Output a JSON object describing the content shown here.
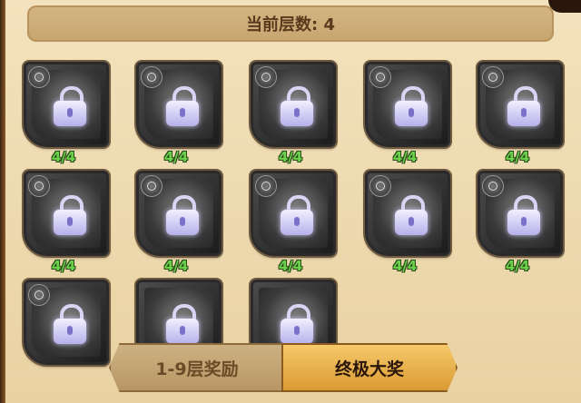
{
  "header": {
    "title": "当前层数: 4"
  },
  "heroes": [
    {
      "id": "hero-1",
      "progress": "4/4",
      "locked": true
    },
    {
      "id": "hero-2",
      "progress": "4/4",
      "locked": true
    },
    {
      "id": "hero-3",
      "progress": "4/4",
      "locked": true
    },
    {
      "id": "hero-4",
      "progress": "4/4",
      "locked": true
    },
    {
      "id": "hero-5",
      "progress": "4/4",
      "locked": true
    },
    {
      "id": "hero-6",
      "progress": "4/4",
      "locked": true
    },
    {
      "id": "hero-7",
      "progress": "4/4",
      "locked": true
    },
    {
      "id": "hero-8",
      "progress": "4/4",
      "locked": true
    },
    {
      "id": "hero-9",
      "progress": "4/4",
      "locked": true
    },
    {
      "id": "hero-10",
      "progress": "4/4",
      "locked": true
    },
    {
      "id": "hero-11",
      "progress": "",
      "locked": true
    },
    {
      "id": "hero-12",
      "progress": "",
      "locked": true
    },
    {
      "id": "hero-13",
      "progress": "",
      "locked": true
    }
  ],
  "tabs": {
    "left_label": "1-9层奖励",
    "right_label": "终极大奖",
    "active": "right"
  },
  "colors": {
    "progress_text": "#6bd14a",
    "panel_bg": "#f3e2bd",
    "active_tab": "#e8b04c"
  },
  "icons": {
    "lock": "lock-icon",
    "emblem": "faction-emblem-icon"
  }
}
